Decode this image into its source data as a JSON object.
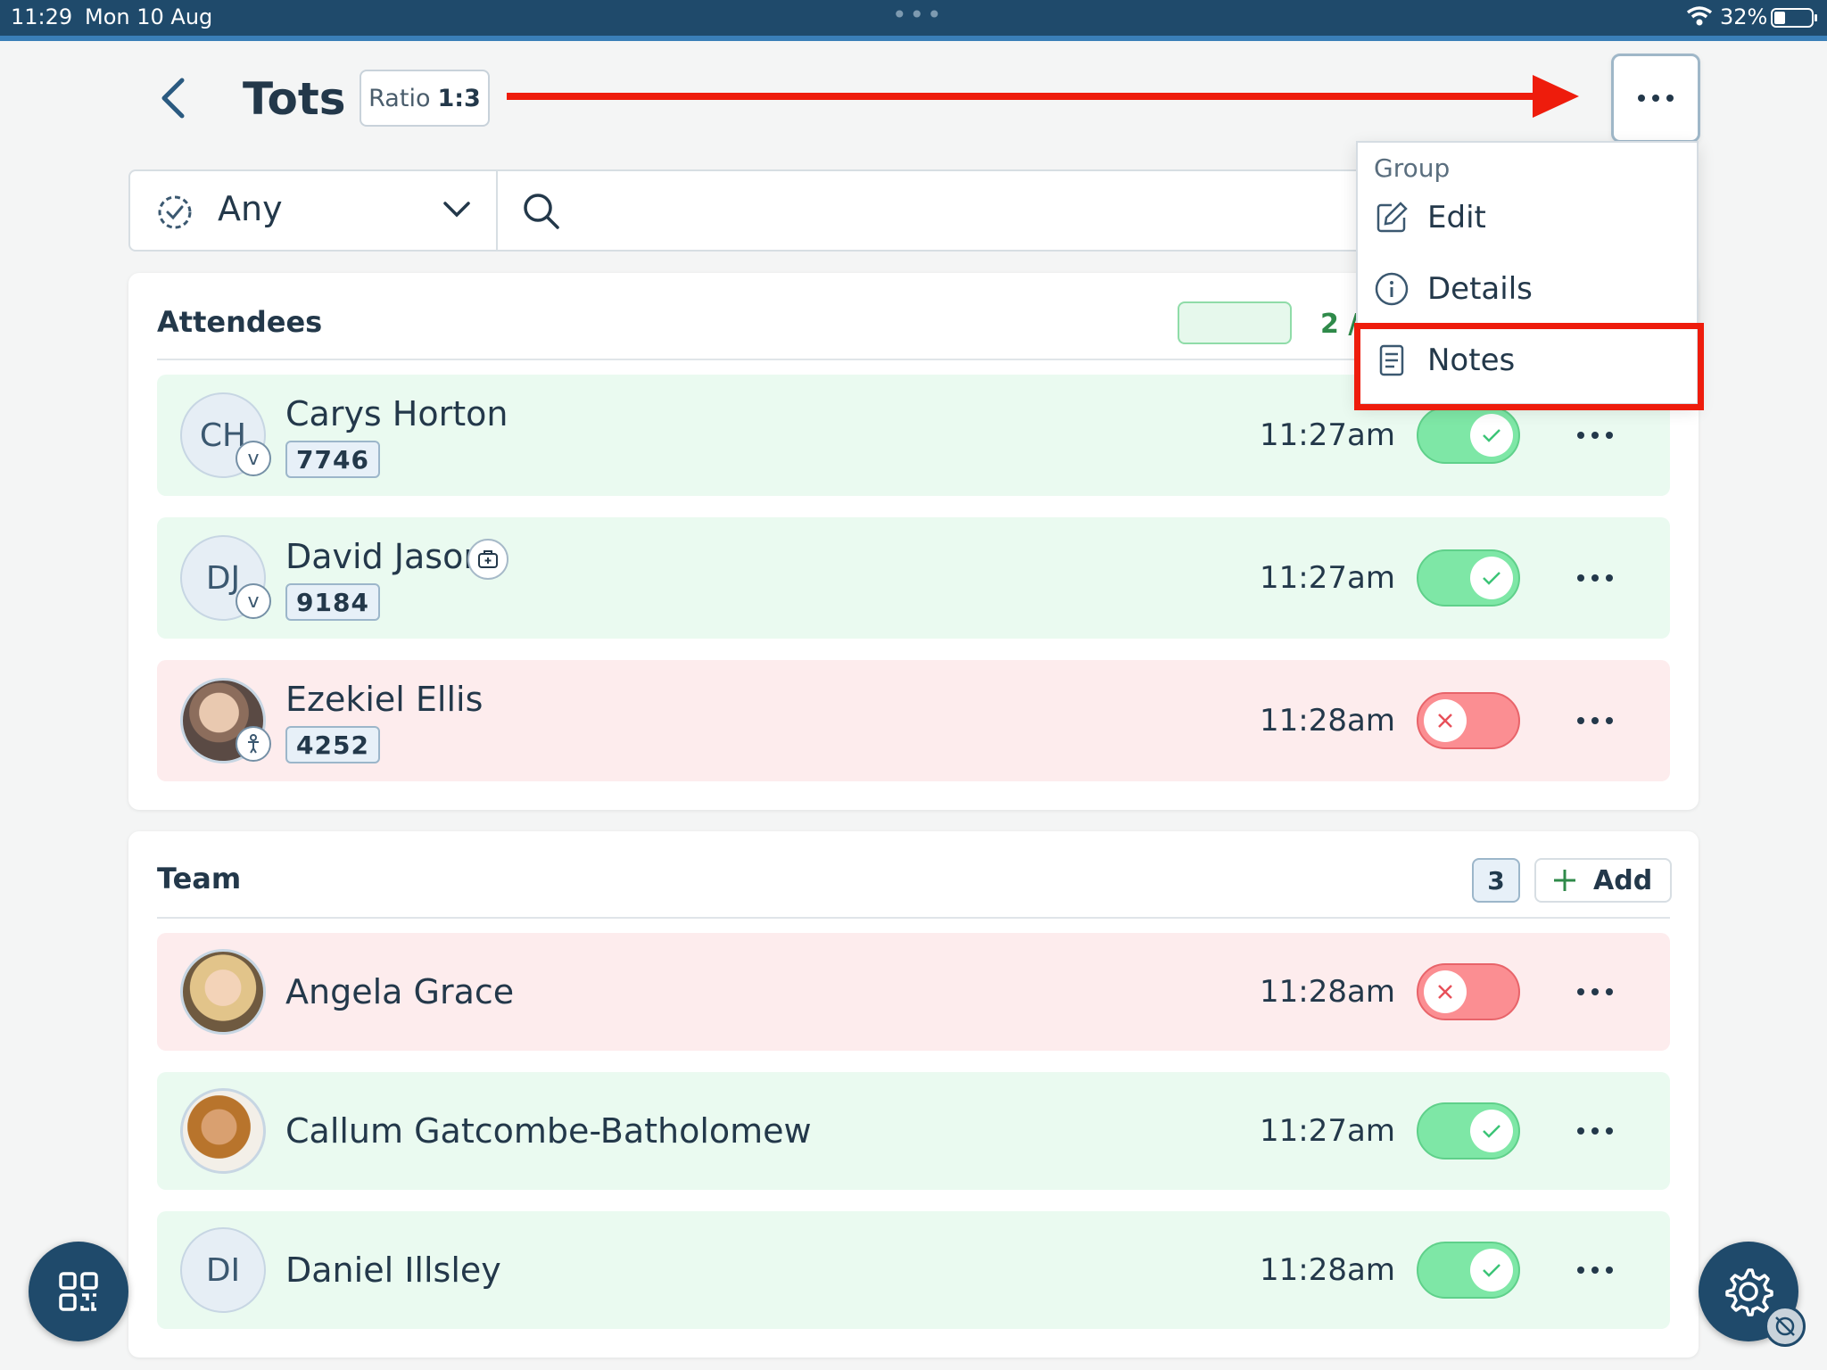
{
  "status_bar": {
    "time": "11:29",
    "date": "Mon 10 Aug",
    "battery": "32%"
  },
  "header": {
    "title": "Tots",
    "ratio_label": "Ratio",
    "ratio_value": "1:3"
  },
  "filter": {
    "selected": "Any"
  },
  "menu": {
    "heading": "Group",
    "items": [
      {
        "label": "Edit",
        "icon": "pencil-icon"
      },
      {
        "label": "Details",
        "icon": "info-icon"
      },
      {
        "label": "Notes",
        "icon": "notes-icon",
        "highlighted": true
      }
    ]
  },
  "attendees": {
    "heading": "Attendees",
    "count": "2 /",
    "rows": [
      {
        "initials": "CH",
        "name": "Carys Horton",
        "id": "7746",
        "time": "11:27am",
        "status": "in",
        "badge": "v"
      },
      {
        "initials": "DJ",
        "name": "David Jason",
        "id": "9184",
        "time": "11:27am",
        "status": "in",
        "badge": "v",
        "medical_icon": "medical-bag-icon"
      },
      {
        "initials": "",
        "name": "Ezekiel Ellis",
        "id": "4252",
        "time": "11:28am",
        "status": "out",
        "badge": "child-icon"
      }
    ]
  },
  "team": {
    "heading": "Team",
    "count": "3",
    "add_label": "Add",
    "rows": [
      {
        "initials": "",
        "name": "Angela Grace",
        "time": "11:28am",
        "status": "out"
      },
      {
        "initials": "",
        "name": "Callum Gatcombe-Batholomew",
        "time": "11:27am",
        "status": "in"
      },
      {
        "initials": "DI",
        "name": "Daniel Illsley",
        "time": "11:28am",
        "status": "in"
      }
    ]
  },
  "colors": {
    "accent": "#1f4a6b",
    "check_in": "#7ee7a6",
    "check_out": "#fb8e92",
    "annotation": "#ee1c0c"
  }
}
